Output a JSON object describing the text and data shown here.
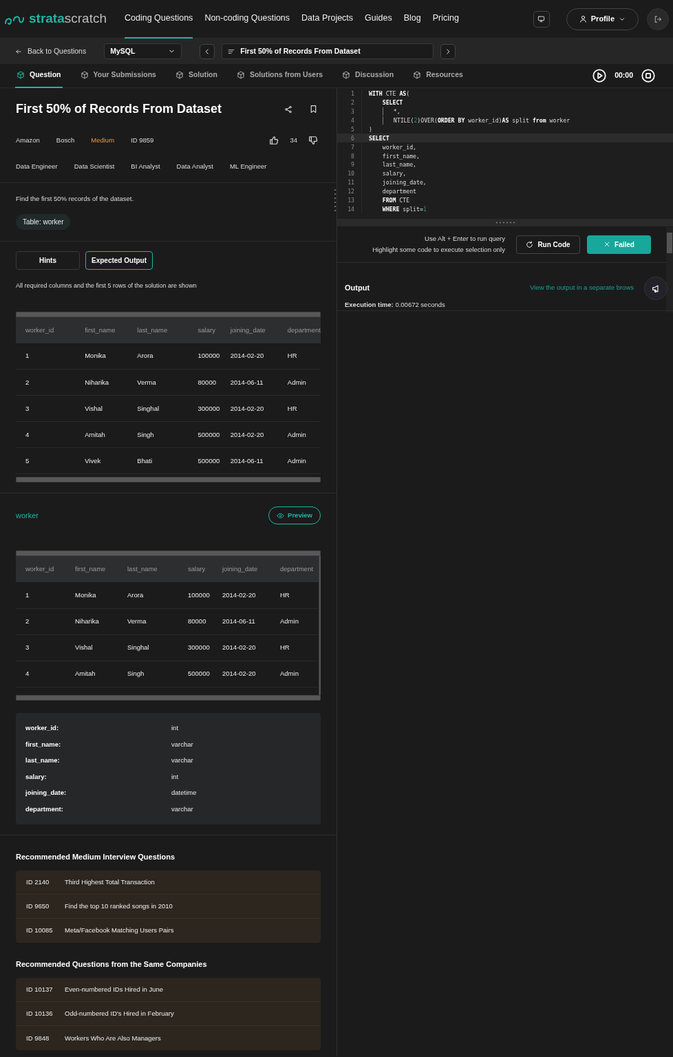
{
  "brand": {
    "part1": "strata",
    "part2": "scratch"
  },
  "nav": [
    {
      "label": "Coding Questions",
      "selected": true
    },
    {
      "label": "Non-coding Questions",
      "selected": false
    },
    {
      "label": "Data Projects",
      "selected": false
    },
    {
      "label": "Guides",
      "selected": false
    },
    {
      "label": "Blog",
      "selected": false
    },
    {
      "label": "Pricing",
      "selected": false
    }
  ],
  "profile_button": "Profile",
  "toolbar": {
    "back": "Back to Questions",
    "language": "MySQL",
    "question": "First 50% of Records From Dataset"
  },
  "tabs": [
    {
      "label": "Question",
      "selected": true
    },
    {
      "label": "Your Submissions",
      "selected": false
    },
    {
      "label": "Solution",
      "selected": false
    },
    {
      "label": "Solutions from Users",
      "selected": false
    },
    {
      "label": "Discussion",
      "selected": false
    },
    {
      "label": "Resources",
      "selected": false
    }
  ],
  "timer": "00:00",
  "question": {
    "title": "First 50% of Records From Dataset",
    "companies": [
      "Amazon",
      "Bosch"
    ],
    "difficulty": "Medium",
    "id": "ID 9859",
    "votes": "34",
    "roles": [
      "Data Engineer",
      "Data Scientist",
      "BI Analyst",
      "Data Analyst",
      "ML Engineer"
    ],
    "description": "Find the first 50% records of the dataset.",
    "table_badge": "Table: worker"
  },
  "output_tabs": [
    {
      "label": "Hints",
      "selected": false
    },
    {
      "label": "Expected Output",
      "selected": true
    }
  ],
  "expected_note": "All required columns and the first 5 rows of the solution are shown",
  "expected_table": {
    "columns": [
      "worker_id",
      "first_name",
      "last_name",
      "salary",
      "joining_date",
      "department"
    ],
    "rows": [
      [
        "1",
        "Monika",
        "Arora",
        "100000",
        "2014-02-20",
        "HR"
      ],
      [
        "2",
        "Niharika",
        "Verma",
        "80000",
        "2014-06-11",
        "Admin"
      ],
      [
        "3",
        "Vishal",
        "Singhal",
        "300000",
        "2014-02-20",
        "HR"
      ],
      [
        "4",
        "Amitah",
        "Singh",
        "500000",
        "2014-02-20",
        "Admin"
      ],
      [
        "5",
        "Vivek",
        "Bhati",
        "500000",
        "2014-06-11",
        "Admin"
      ]
    ]
  },
  "dataset": {
    "name": "worker",
    "preview": "Preview",
    "table": {
      "columns": [
        "worker_id",
        "first_name",
        "last_name",
        "salary",
        "joining_date",
        "department"
      ],
      "rows": [
        [
          "1",
          "Monika",
          "Arora",
          "100000",
          "2014-02-20",
          "HR"
        ],
        [
          "2",
          "Niharika",
          "Verma",
          "80000",
          "2014-06-11",
          "Admin"
        ],
        [
          "3",
          "Vishal",
          "Singhal",
          "300000",
          "2014-02-20",
          "HR"
        ],
        [
          "4",
          "Amitah",
          "Singh",
          "500000",
          "2014-02-20",
          "Admin"
        ]
      ]
    },
    "schema": [
      {
        "column": "worker_id:",
        "type": "int"
      },
      {
        "column": "first_name:",
        "type": "varchar"
      },
      {
        "column": "last_name:",
        "type": "varchar"
      },
      {
        "column": "salary:",
        "type": "int"
      },
      {
        "column": "joining_date:",
        "type": "datetime"
      },
      {
        "column": "department:",
        "type": "varchar"
      }
    ]
  },
  "recommended": [
    {
      "title": "Recommended Medium Interview Questions",
      "items": [
        {
          "id": "ID 2140",
          "title": "Third Highest Total Transaction"
        },
        {
          "id": "ID 9650",
          "title": "Find the top 10 ranked songs in 2010"
        },
        {
          "id": "ID 10085",
          "title": "Meta/Facebook Matching Users Pairs"
        }
      ]
    },
    {
      "title": "Recommended Questions from the Same Companies",
      "items": [
        {
          "id": "ID 10137",
          "title": "Even-numbered IDs Hired in June"
        },
        {
          "id": "ID 10136",
          "title": "Odd-numbered ID's Hired in February"
        },
        {
          "id": "ID 9848",
          "title": "Workers Who Are Also Managers"
        }
      ]
    }
  ],
  "editor": {
    "lines": [
      {
        "number": "1",
        "current": false,
        "guide": false,
        "tokens": [
          {
            "kind": "kw",
            "text": "WITH"
          },
          {
            "kind": "plain",
            "text": " CTE "
          },
          {
            "kind": "kw",
            "text": "AS"
          },
          {
            "kind": "plain",
            "text": "("
          }
        ]
      },
      {
        "number": "2",
        "current": false,
        "guide": false,
        "tokens": [
          {
            "kind": "kw",
            "text": "    SELECT"
          }
        ]
      },
      {
        "number": "3",
        "current": false,
        "guide": true,
        "tokens": [
          {
            "kind": "plain",
            "text": "   *,"
          }
        ]
      },
      {
        "number": "4",
        "current": false,
        "guide": true,
        "tokens": [
          {
            "kind": "plain",
            "text": "   NTILE("
          },
          {
            "kind": "num",
            "text": "2"
          },
          {
            "kind": "plain",
            "text": ")OVER("
          },
          {
            "kind": "kw",
            "text": "ORDER BY"
          },
          {
            "kind": "plain",
            "text": " worker_id)"
          },
          {
            "kind": "kw",
            "text": "AS"
          },
          {
            "kind": "plain",
            "text": " split "
          },
          {
            "kind": "kw",
            "text": "from"
          },
          {
            "kind": "plain",
            "text": " worker"
          }
        ]
      },
      {
        "number": "5",
        "current": false,
        "guide": false,
        "tokens": [
          {
            "kind": "plain",
            "text": ")"
          }
        ]
      },
      {
        "number": "6",
        "current": true,
        "guide": false,
        "tokens": [
          {
            "kind": "kw",
            "text": "SELECT"
          }
        ]
      },
      {
        "number": "7",
        "current": false,
        "guide": false,
        "tokens": [
          {
            "kind": "plain",
            "text": "    worker_id,"
          }
        ]
      },
      {
        "number": "8",
        "current": false,
        "guide": false,
        "tokens": [
          {
            "kind": "plain",
            "text": "    first_name,"
          }
        ]
      },
      {
        "number": "9",
        "current": false,
        "guide": false,
        "tokens": [
          {
            "kind": "plain",
            "text": "    last_name,"
          }
        ]
      },
      {
        "number": "10",
        "current": false,
        "guide": false,
        "tokens": [
          {
            "kind": "plain",
            "text": "    salary,"
          }
        ]
      },
      {
        "number": "11",
        "current": false,
        "guide": false,
        "tokens": [
          {
            "kind": "plain",
            "text": "    joining_date,"
          }
        ]
      },
      {
        "number": "12",
        "current": false,
        "guide": false,
        "tokens": [
          {
            "kind": "plain",
            "text": "    department"
          }
        ]
      },
      {
        "number": "13",
        "current": false,
        "guide": false,
        "tokens": [
          {
            "kind": "kw",
            "text": "    FROM"
          },
          {
            "kind": "plain",
            "text": " CTE"
          }
        ]
      },
      {
        "number": "14",
        "current": false,
        "guide": false,
        "tokens": [
          {
            "kind": "kw",
            "text": "    WHERE"
          },
          {
            "kind": "plain",
            "text": " split="
          },
          {
            "kind": "num",
            "text": "1"
          }
        ]
      }
    ]
  },
  "runner": {
    "hint_lines": [
      "Use Alt + Enter to run query",
      "Highlight some code to execute selection only"
    ],
    "run_button": "Run Code",
    "status_button": "Failed"
  },
  "output": {
    "title": "Output",
    "link": "View the output in a separate brows",
    "execution": "**Execution time:** 0.00672 seconds"
  }
}
